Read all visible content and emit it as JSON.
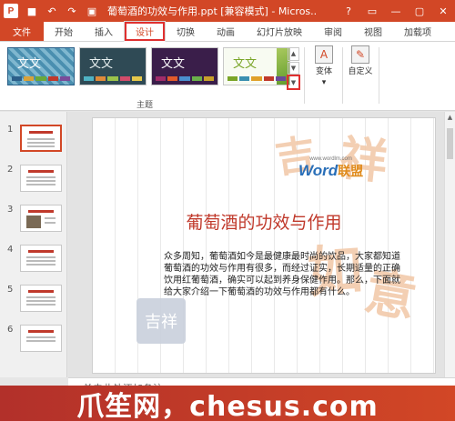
{
  "window": {
    "title": "葡萄酒的功效与作用.ppt [兼容模式] - Micros...",
    "app_badge": "P",
    "qat_icons": [
      "save-icon",
      "undo-icon",
      "redo-icon",
      "start-slideshow-icon"
    ],
    "controls": [
      "?",
      "▭",
      "—",
      "▢",
      "✕"
    ]
  },
  "tabs": [
    {
      "label": "文件"
    },
    {
      "label": "开始"
    },
    {
      "label": "插入"
    },
    {
      "label": "设计"
    },
    {
      "label": "切换"
    },
    {
      "label": "动画"
    },
    {
      "label": "幻灯片放映"
    },
    {
      "label": "审阅"
    },
    {
      "label": "视图"
    },
    {
      "label": "加载项"
    }
  ],
  "ribbon": {
    "theme_label": "文文",
    "themes_group_label": "主题",
    "variants_label": "变体",
    "customize_label": "自定义"
  },
  "slides_panel": {
    "numbers": [
      "1",
      "2",
      "3",
      "4",
      "5",
      "6"
    ]
  },
  "slide": {
    "watermark_url": "www.wordlm.com",
    "watermark_word": "Word",
    "watermark_union": "联盟",
    "deco_chars": [
      "吉",
      "祥",
      "如",
      "意"
    ],
    "stamp_text": "吉祥",
    "title": "葡萄酒的功效与作用",
    "body": "众多周知，葡萄酒如今是最健康最时尚的饮品，大家都知道葡萄酒的功效与作用有很多，而经过证实，长期适量的正确饮用红葡萄酒，确实可以起到养身保健作用。那么，下面就给大家介绍一下葡萄酒的功效与作用都有什么。"
  },
  "notes": {
    "placeholder": "单击此处添加备注"
  },
  "banner": {
    "text": "爪笙网，chesus.com"
  },
  "colors": {
    "accent": "#d24726",
    "title_red": "#c0392b"
  }
}
